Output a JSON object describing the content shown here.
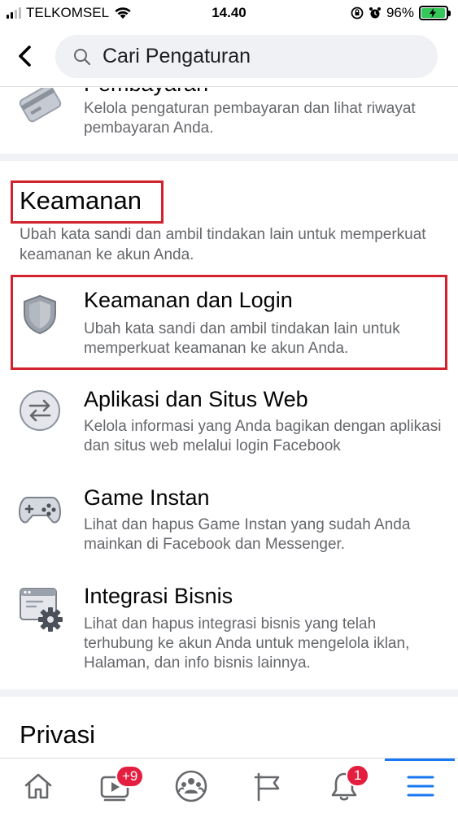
{
  "status_bar": {
    "carrier": "TELKOMSEL",
    "time": "14.40",
    "battery": "96%",
    "battery_level": 0.96
  },
  "header": {
    "search_placeholder": "Cari Pengaturan"
  },
  "payment_item": {
    "title": "Pembayaran",
    "description": "Kelola pengaturan pembayaran dan lihat riwayat pembayaran Anda.",
    "icon": "credit-card-icon"
  },
  "security_section": {
    "title": "Keamanan",
    "description": "Ubah kata sandi dan ambil tindakan lain untuk memperkuat keamanan ke akun Anda.",
    "items": [
      {
        "title": "Keamanan dan Login",
        "description": "Ubah kata sandi dan ambil tindakan lain untuk memperkuat keamanan ke akun Anda.",
        "icon": "shield-icon"
      },
      {
        "title": "Aplikasi dan Situs Web",
        "description": "Kelola informasi yang Anda bagikan dengan aplikasi dan situs web melalui login Facebook",
        "icon": "arrows-exchange-icon"
      },
      {
        "title": "Game Instan",
        "description": "Lihat dan hapus Game Instan yang sudah Anda mainkan di Facebook dan Messenger.",
        "icon": "gamepad-icon"
      },
      {
        "title": "Integrasi Bisnis",
        "description": "Lihat dan hapus integrasi bisnis yang telah terhubung ke akun Anda untuk mengelola iklan, Halaman, dan info bisnis lainnya.",
        "icon": "browser-gear-icon"
      }
    ]
  },
  "privacy_section": {
    "title": "Privasi"
  },
  "bottom_nav": {
    "watch_badge": "+9",
    "notifications_badge": "1",
    "active_tab": "menu"
  },
  "colors": {
    "highlight_box": "#d2222d",
    "accent": "#1877f2",
    "badge": "#e41e3f"
  }
}
